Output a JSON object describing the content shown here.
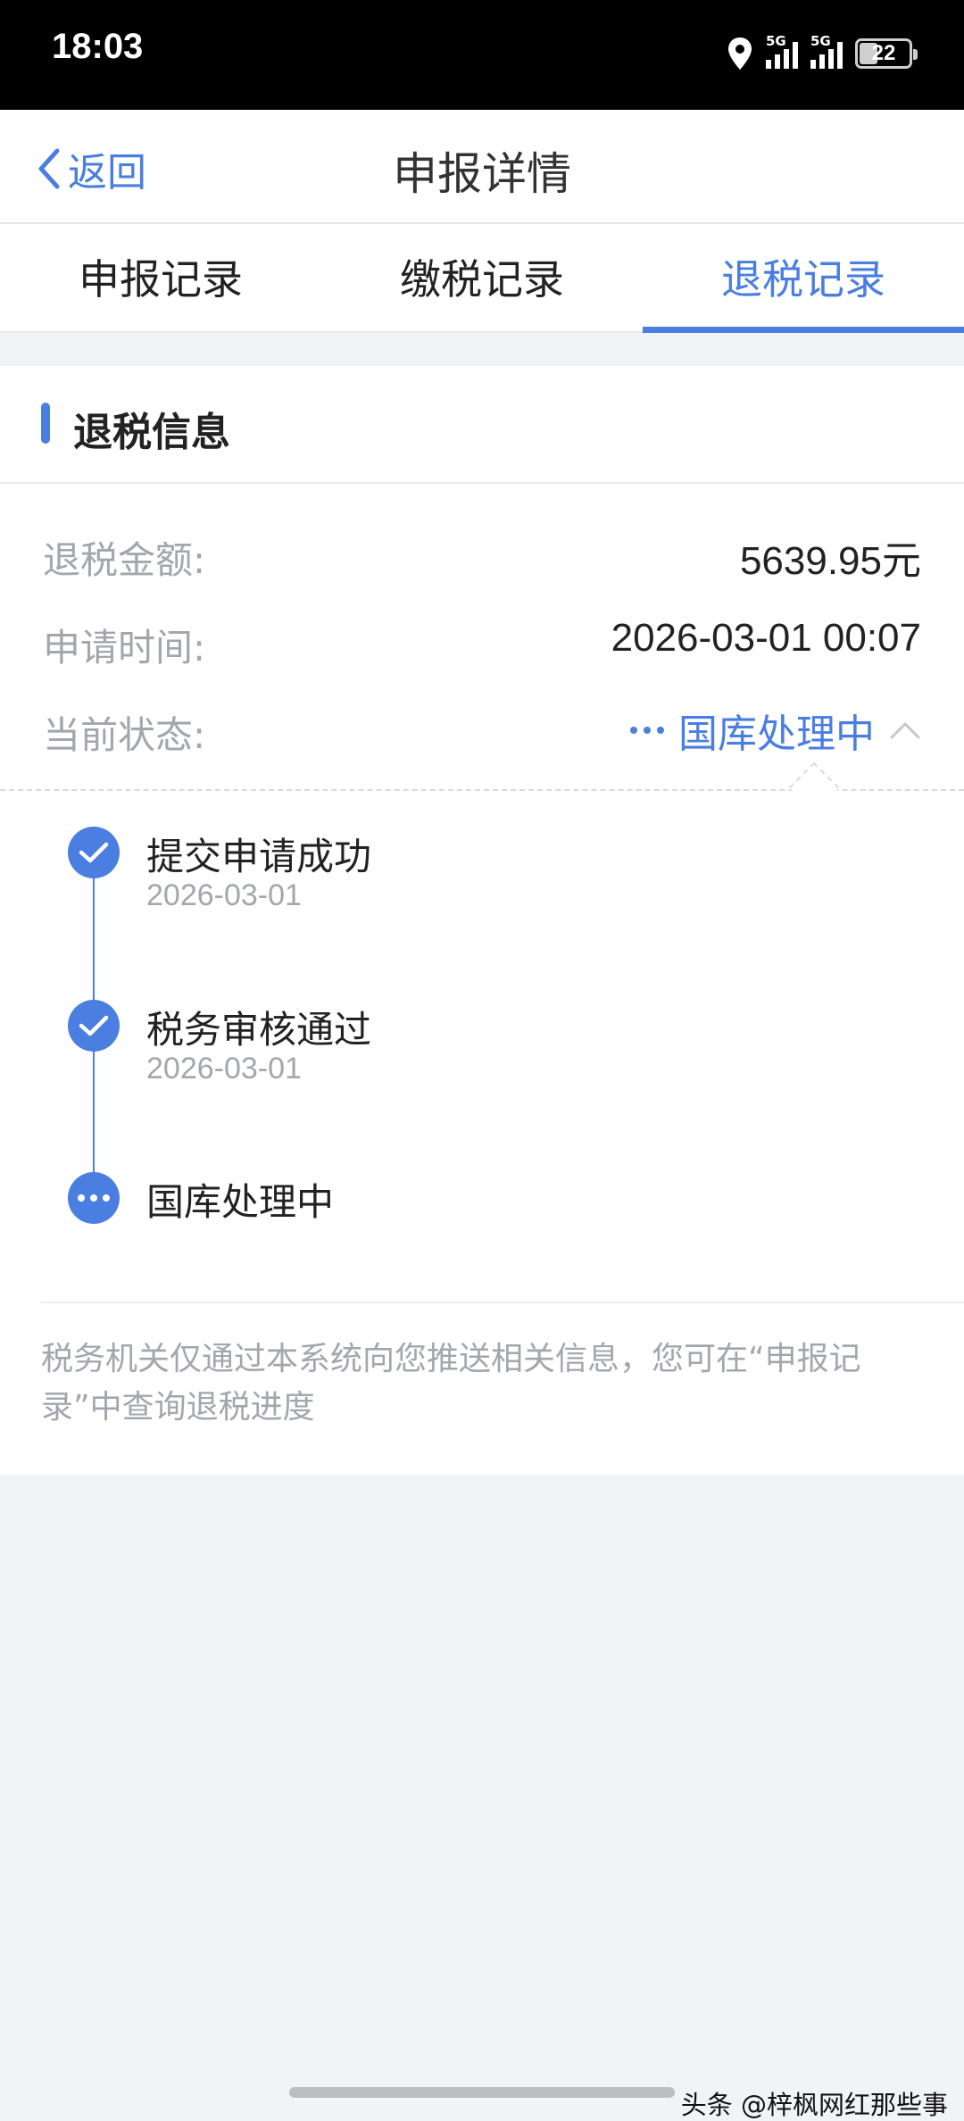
{
  "status_bar": {
    "time": "18:03",
    "network_1": "5G",
    "network_2": "5G",
    "battery": "22"
  },
  "nav": {
    "back_label": "返回",
    "title": "申报详情"
  },
  "tabs": [
    {
      "label": "申报记录",
      "active": false
    },
    {
      "label": "缴税记录",
      "active": false
    },
    {
      "label": "退税记录",
      "active": true
    }
  ],
  "section": {
    "title": "退税信息"
  },
  "details": {
    "amount_label": "退税金额:",
    "amount_value": "5639.95元",
    "time_label": "申请时间:",
    "time_value": "2026-03-01 00:07",
    "status_label": "当前状态:",
    "status_value": "国库处理中"
  },
  "timeline": [
    {
      "title": "提交申请成功",
      "date": "2026-03-01",
      "state": "done"
    },
    {
      "title": "税务审核通过",
      "date": "2026-03-01",
      "state": "done"
    },
    {
      "title": "国库处理中",
      "date": "",
      "state": "in-progress"
    }
  ],
  "notice": "税务机关仅通过本系统向您推送相关信息，您可在“申报记录”中查询退税进度",
  "watermark": "头条 @梓枫网红那些事",
  "colors": {
    "accent": "#4a7ee0",
    "muted_text": "#a3a6ad",
    "background": "#f2f3f7"
  },
  "icons": {
    "back": "chevron-left-icon",
    "location": "location-pin-icon",
    "collapse": "chevron-up-icon",
    "done": "check-icon",
    "pending": "more-dots-icon"
  }
}
